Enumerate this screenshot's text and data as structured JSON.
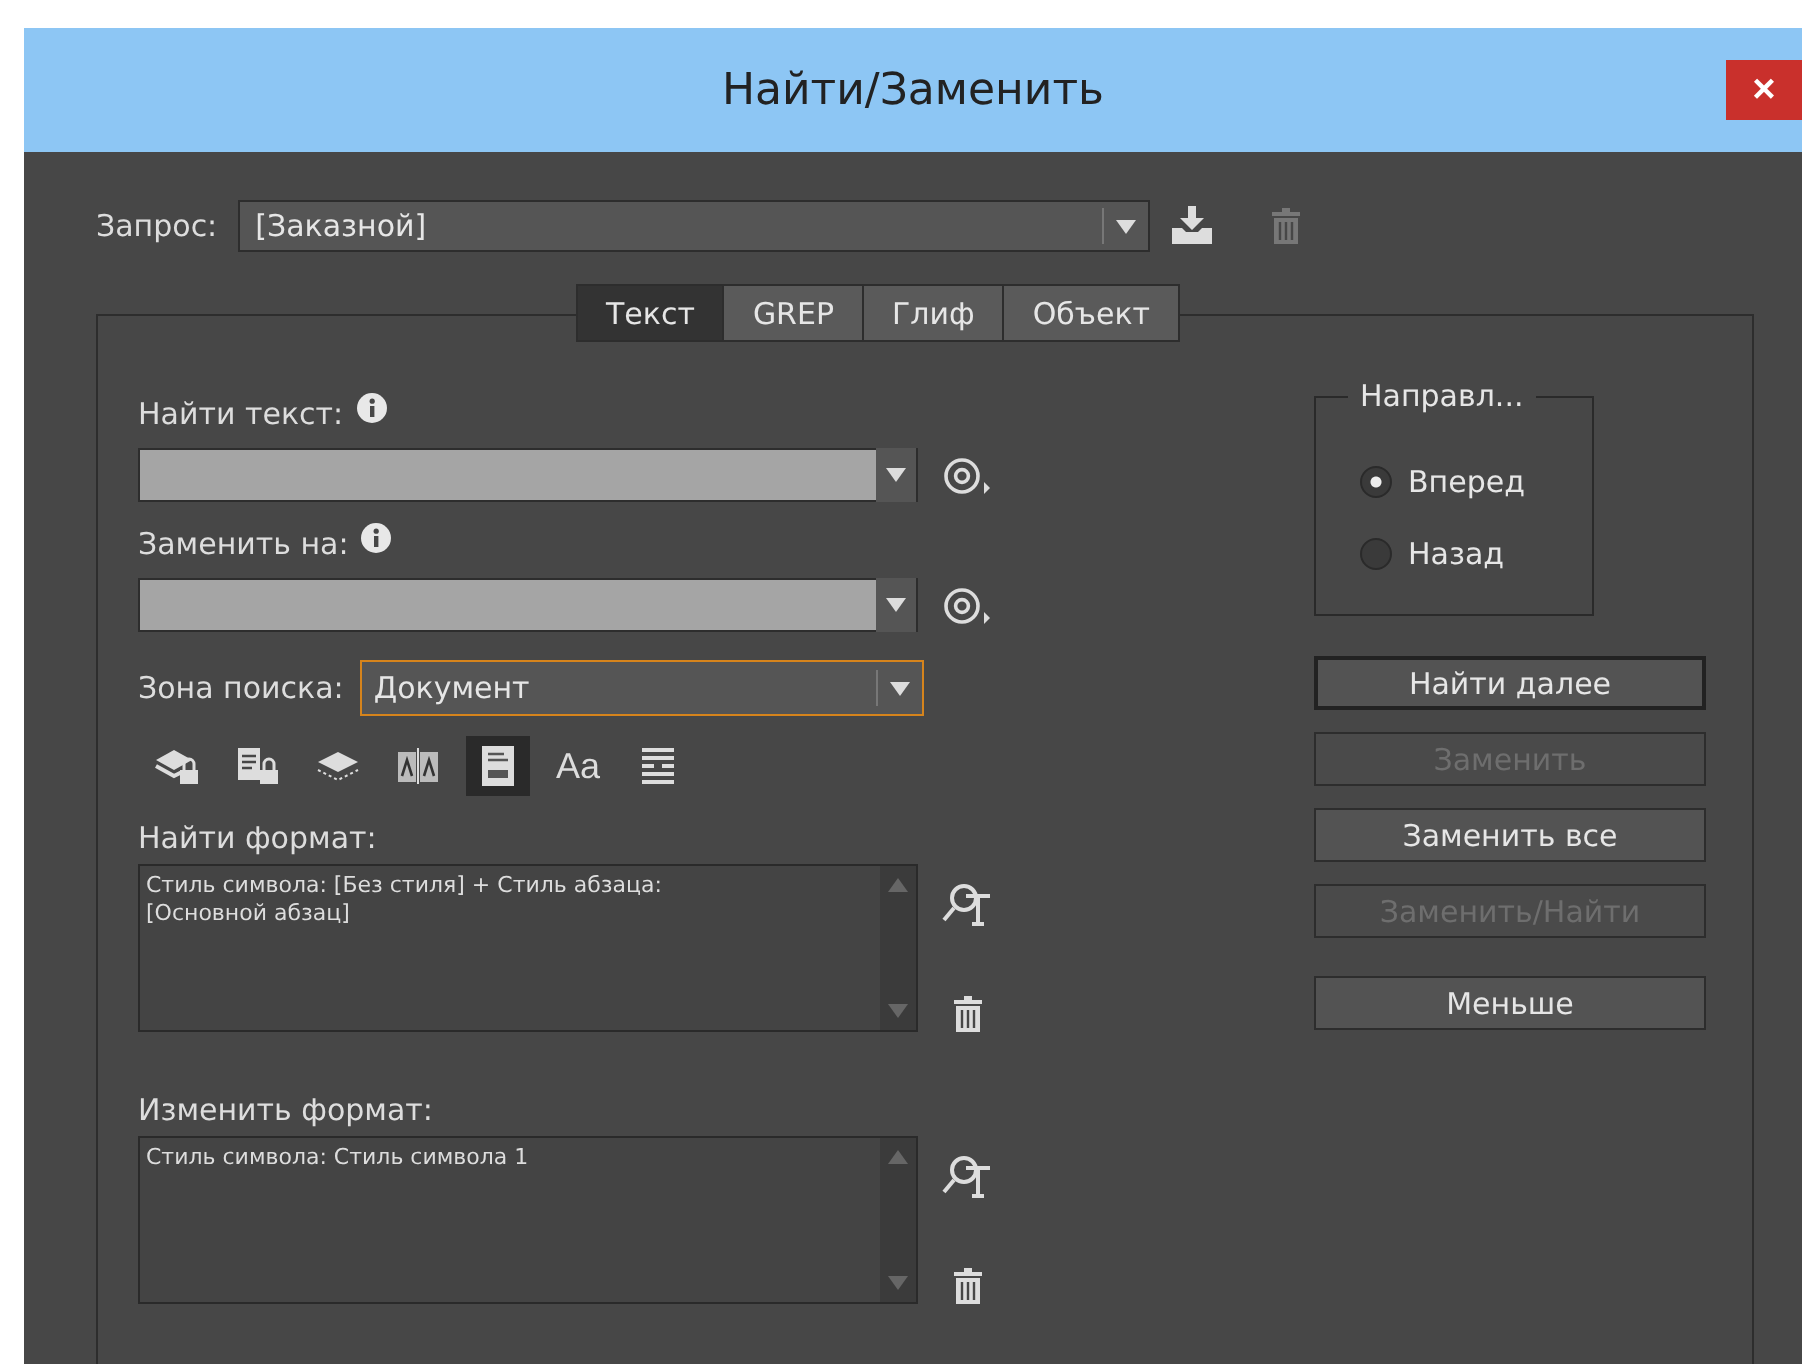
{
  "window": {
    "title": "Найти/Заменить",
    "close": "×"
  },
  "query": {
    "label": "Запрос:",
    "value": "[Заказной]"
  },
  "tabs": [
    {
      "label": "Текст",
      "selected": true
    },
    {
      "label": "GREP",
      "selected": false
    },
    {
      "label": "Глиф",
      "selected": false
    },
    {
      "label": "Объект",
      "selected": false
    }
  ],
  "find_text": {
    "label": "Найти текст:"
  },
  "replace_text": {
    "label": "Заменить на:"
  },
  "search_zone": {
    "label": "Зона поиска:",
    "value": "Документ"
  },
  "options": [
    {
      "kind": "layers-lock",
      "on": false
    },
    {
      "kind": "page-lock",
      "on": false
    },
    {
      "kind": "layers",
      "on": false
    },
    {
      "kind": "book",
      "on": false
    },
    {
      "kind": "note",
      "on": true
    },
    {
      "kind": "case",
      "label": "Aa",
      "on": false
    },
    {
      "kind": "lines",
      "on": false
    }
  ],
  "find_format": {
    "label": "Найти формат:",
    "value": "Стиль символа: [Без стиля] + Стиль абзаца: [Основной абзац]"
  },
  "change_format": {
    "label": "Изменить формат:",
    "value": "Стиль символа: Стиль символа 1"
  },
  "direction": {
    "title": "Направл...",
    "options": [
      {
        "label": "Вперед",
        "selected": true
      },
      {
        "label": "Назад",
        "selected": false
      }
    ]
  },
  "buttons": [
    {
      "label": "Найти далее",
      "disabled": false,
      "default": true
    },
    {
      "label": "Заменить",
      "disabled": true,
      "default": false
    },
    {
      "label": "Заменить все",
      "disabled": false,
      "default": false
    },
    {
      "label": "Заменить/Найти",
      "disabled": true,
      "default": false
    },
    {
      "label": "Меньше",
      "disabled": false,
      "default": false
    }
  ]
}
